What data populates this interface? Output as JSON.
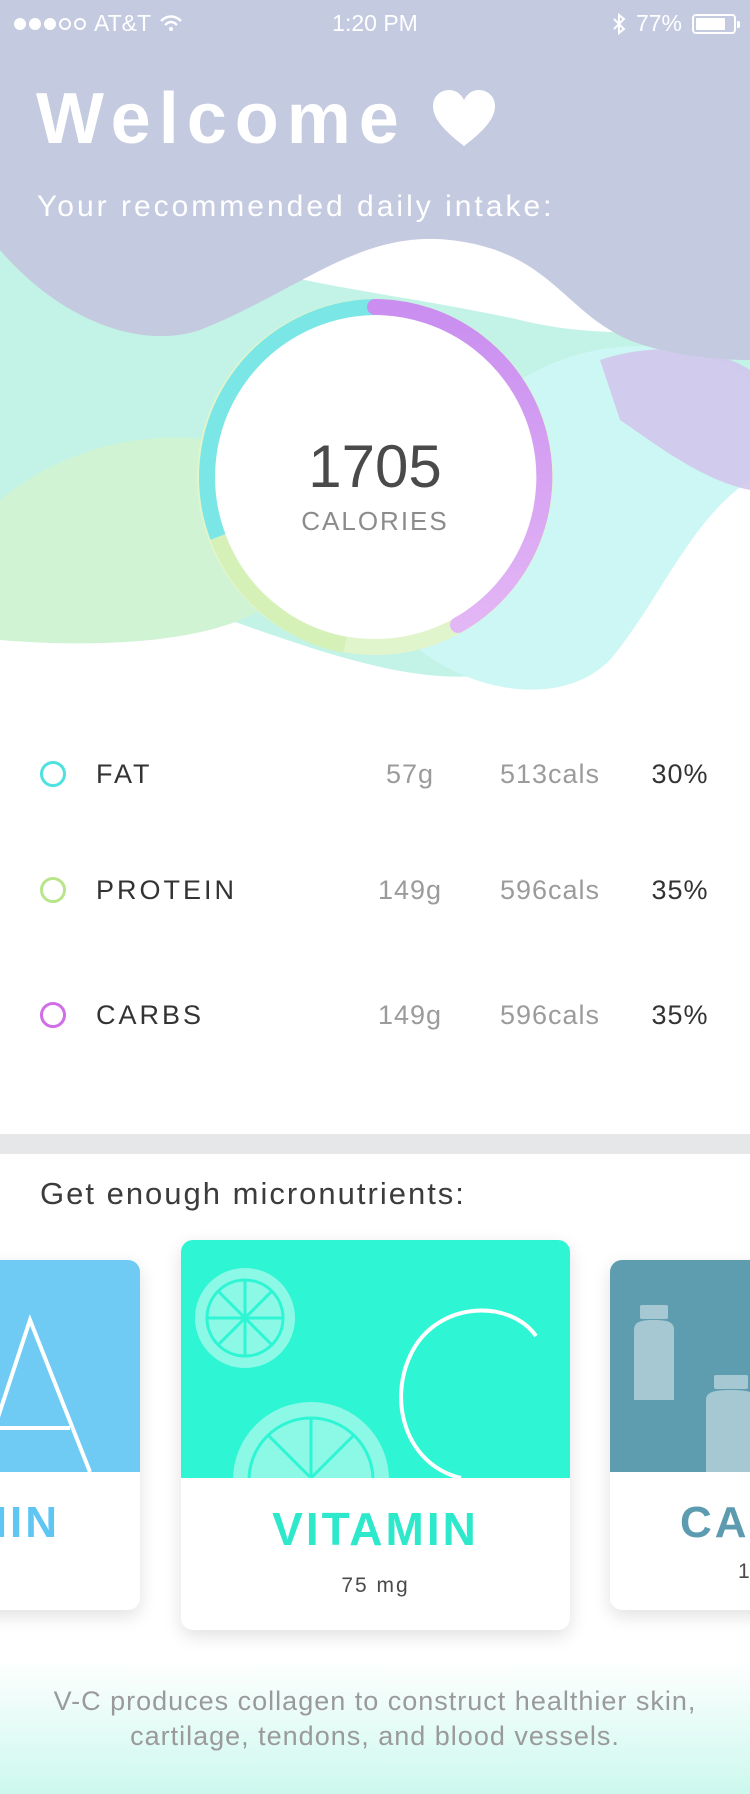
{
  "status_bar": {
    "carrier": "AT&T",
    "time": "1:20 PM",
    "battery": "77%",
    "signal_bars_filled": 3,
    "signal_bars_total": 5,
    "battery_level": 0.77,
    "icons": [
      "wifi-icon",
      "bluetooth-icon",
      "battery-icon"
    ]
  },
  "header": {
    "title": "Welcome",
    "subtitle": "Your recommended daily intake:",
    "icon": "heart-icon"
  },
  "calories": {
    "value": "1705",
    "label": "CALORIES"
  },
  "macros": [
    {
      "name": "FAT",
      "grams": "57g",
      "cals": "513cals",
      "percent": "30%",
      "color": "#4fe0e0"
    },
    {
      "name": "PROTEIN",
      "grams": "149g",
      "cals": "596cals",
      "percent": "35%",
      "color": "#b9e58a"
    },
    {
      "name": "CARBS",
      "grams": "149g",
      "cals": "596cals",
      "percent": "35%",
      "color": "#cf6ee6"
    }
  ],
  "micronutrients": {
    "title": "Get enough micronutrients:",
    "cards": [
      {
        "letter": "A",
        "title": "VITAMIN",
        "amount": "",
        "color": "#6fcbf3",
        "title_color": "#5fc6f4"
      },
      {
        "letter": "C",
        "title": "VITAMIN",
        "amount": "75 mg",
        "color": "#2ef5d4",
        "title_color": "#2ee8cb"
      },
      {
        "letter": "",
        "title": "CA",
        "amount": "1",
        "color": "#5e9caf",
        "title_color": "#5d9bb0"
      }
    ],
    "description": "V-C produces collagen to construct healthier skin, cartilage, tendons, and blood vessels."
  },
  "colors": {
    "hero_lavender": "#c4cae0",
    "blob_mint": "#b9f2e6",
    "blob_green": "#cdf3d2",
    "blob_cyan": "#cdf7f4",
    "blob_purple": "#d2c7ec"
  }
}
